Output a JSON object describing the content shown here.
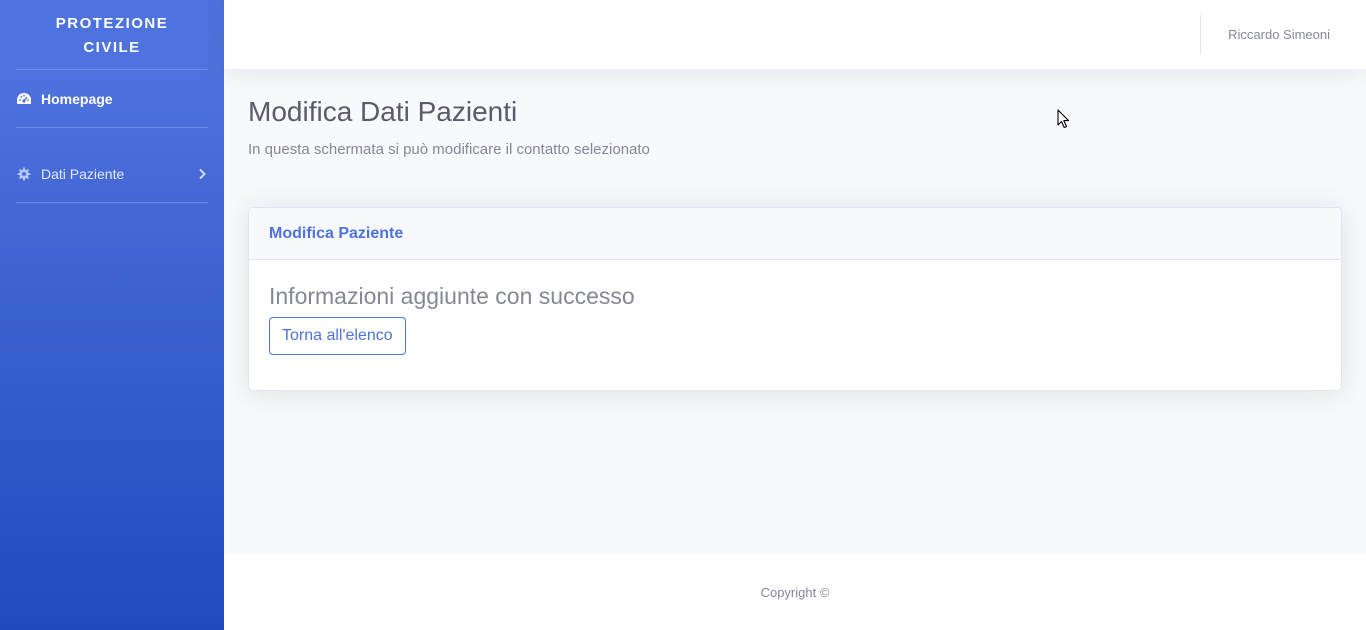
{
  "sidebar": {
    "brand_line1": "PROTEZIONE",
    "brand_line2": "CIVILE",
    "items": [
      {
        "label": "Homepage",
        "icon": "tachometer-icon",
        "active": true
      },
      {
        "label": "Dati Paziente",
        "icon": "gear-icon",
        "has_submenu": true
      }
    ]
  },
  "topbar": {
    "user_name": "Riccardo Simeoni"
  },
  "page": {
    "title": "Modifica Dati Pazienti",
    "subtitle": "In questa schermata si può modificare il contatto selezionato"
  },
  "card": {
    "header": "Modifica Paziente",
    "message": "Informazioni aggiunte con successo",
    "back_button_label": "Torna all'elenco"
  },
  "footer": {
    "copyright": "Copyright ©"
  },
  "colors": {
    "primary": "#4e73df",
    "primary_dark": "#224abe",
    "muted_text": "#858796",
    "heading_text": "#5a5c69",
    "page_bg": "#f8f9fc"
  }
}
